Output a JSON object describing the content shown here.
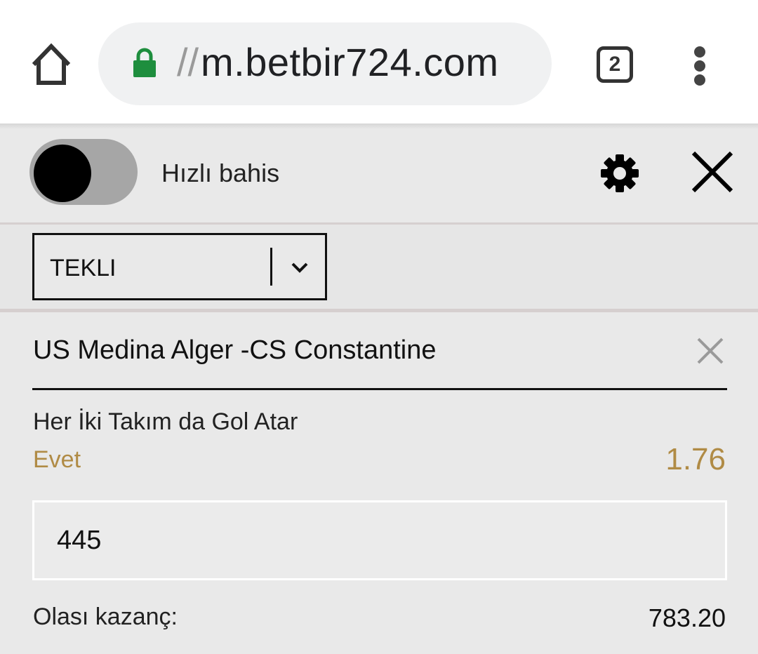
{
  "browser": {
    "url_prefix": "//",
    "url": "m.betbir724.com",
    "tab_count": "2",
    "icons": [
      "home-icon",
      "lock-icon",
      "more-vert-icon"
    ],
    "secure_color": "#1e8e3e"
  },
  "header": {
    "quick_bet_label": "Hızlı bahis",
    "quick_bet_enabled": false,
    "icons": [
      "settings-gear-icon",
      "close-icon"
    ]
  },
  "bet_type": {
    "selected": "TEKLI"
  },
  "bet": {
    "match": "US Medina Alger -CS Constantine",
    "market": "Her İki Takım da Gol Atar",
    "selection": "Evet",
    "odds": "1.76",
    "stake": "445",
    "potential_win_label": "Olası kazanç:",
    "potential_win": "783.20"
  },
  "colors": {
    "accent_gold": "#b08b45",
    "background": "#e9e9e9"
  }
}
